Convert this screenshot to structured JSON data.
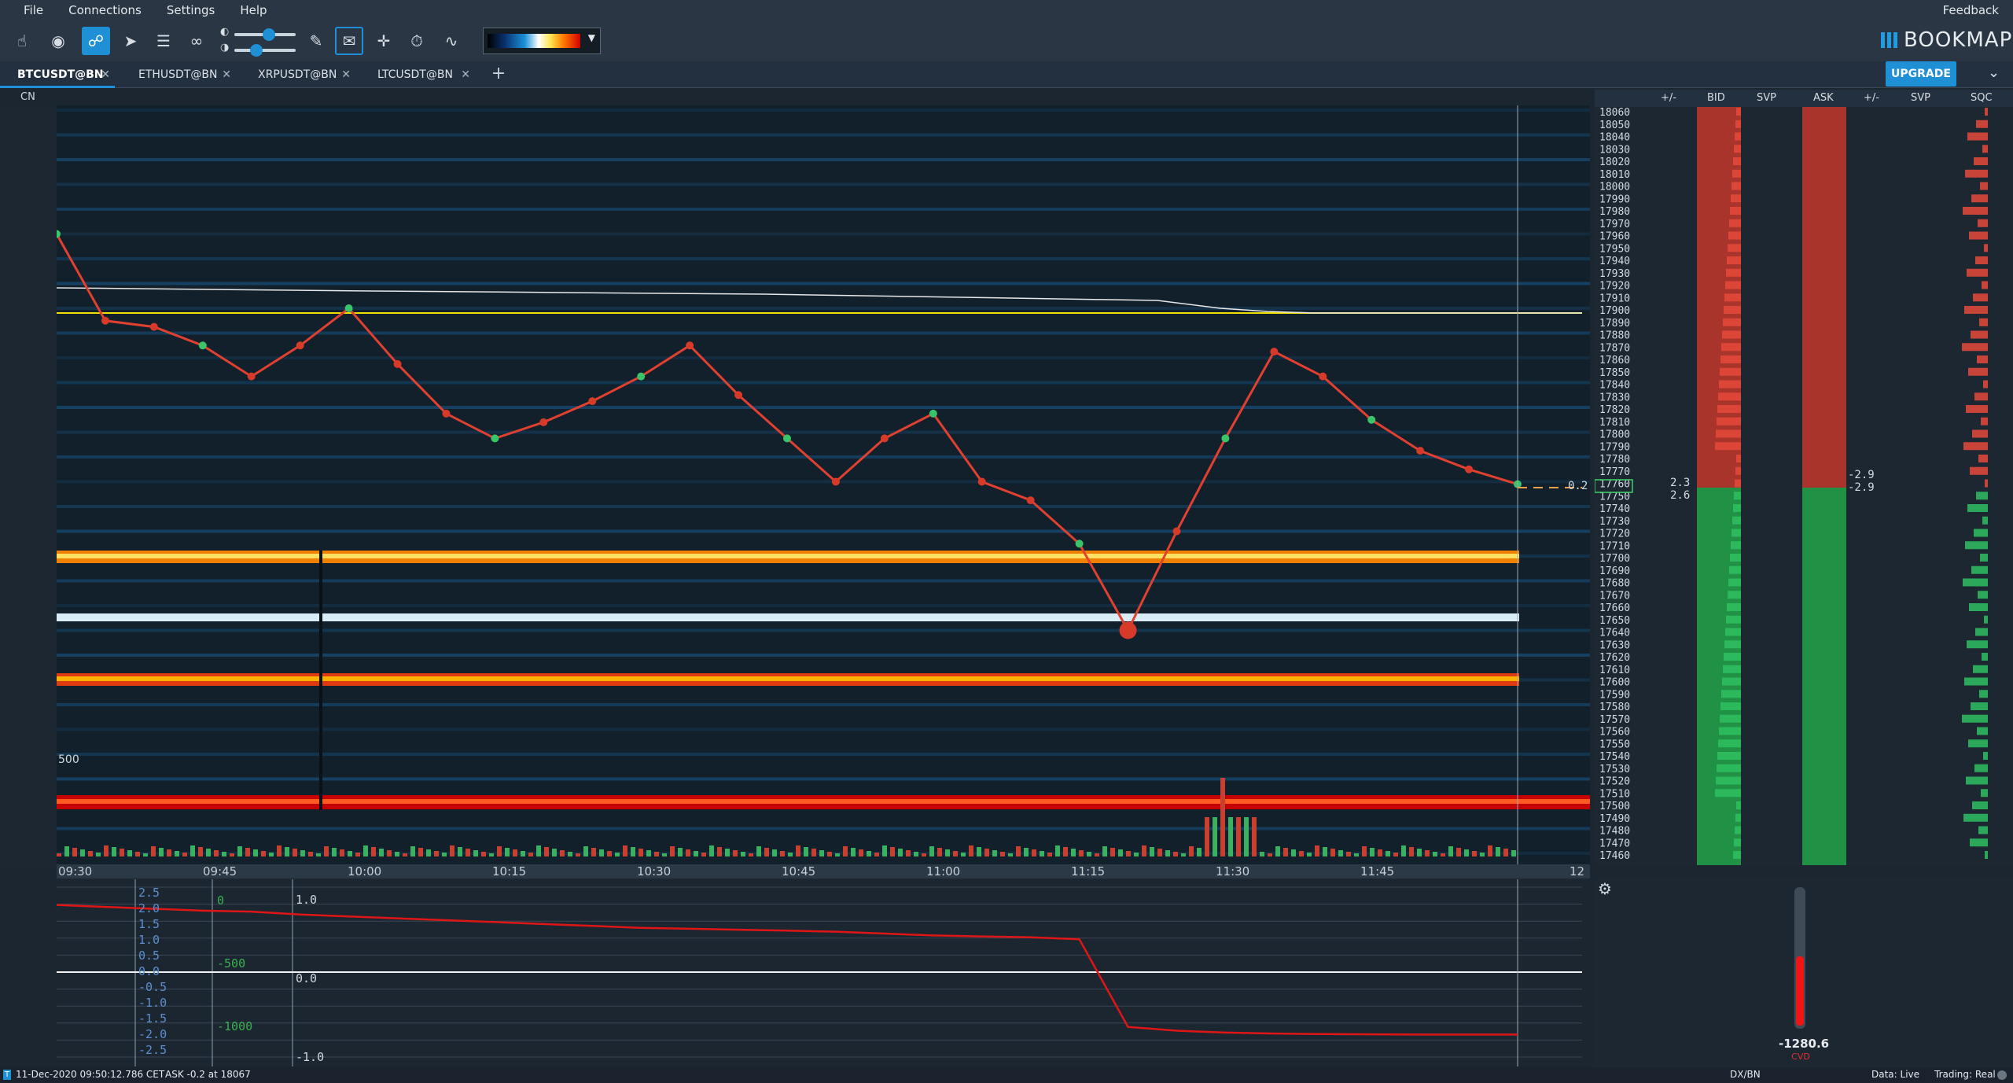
{
  "menu": [
    "File",
    "Connections",
    "Settings",
    "Help"
  ],
  "feedback": "Feedback",
  "brand": "BOOKMAP",
  "upgrade": "UPGRADE",
  "tabs": [
    {
      "label": "BTCUSDT@BN",
      "active": true
    },
    {
      "label": "ETHUSDT@BN",
      "active": false
    },
    {
      "label": "XRPUSDT@BN",
      "active": false
    },
    {
      "label": "LTCUSDT@BN",
      "active": false
    }
  ],
  "chart_label": "CN",
  "min_size_label": "500",
  "ladder_headers": [
    "+/-",
    "BID",
    "SVP",
    "ASK",
    "+/-",
    "SVP",
    "SQC"
  ],
  "price_levels": [
    18060,
    18050,
    18040,
    18030,
    18020,
    18010,
    18000,
    17990,
    17980,
    17970,
    17960,
    17950,
    17940,
    17930,
    17920,
    17910,
    17900,
    17890,
    17880,
    17870,
    17860,
    17850,
    17840,
    17830,
    17820,
    17810,
    17800,
    17790,
    17780,
    17770,
    17760,
    17750,
    17740,
    17730,
    17720,
    17710,
    17700,
    17690,
    17680,
    17670,
    17660,
    17650,
    17640,
    17630,
    17620,
    17610,
    17600,
    17590,
    17580,
    17570,
    17560,
    17550,
    17540,
    17530,
    17520,
    17510,
    17500,
    17490,
    17480,
    17470,
    17460
  ],
  "current_price": "17758",
  "inside_ask_size": "0.2",
  "ladder_side_values": {
    "a": "2.3",
    "b": "2.6",
    "c": "-2.9",
    "d": "-2.9"
  },
  "time_labels": [
    "09:30",
    "09:45",
    "10:00",
    "10:15",
    "10:30",
    "10:45",
    "11:00",
    "11:15",
    "11:30",
    "11:45",
    "12"
  ],
  "lower_left_labels": [
    "2.5",
    "2.0",
    "1.5",
    "1.0",
    "0.5",
    "0.0",
    "-0.5",
    "-1.0",
    "-1.5",
    "-2.0",
    "-2.5"
  ],
  "lower_mid_labels": [
    "0",
    "-500",
    "-1000"
  ],
  "lower_right_labels": [
    "1.0",
    "0.0",
    "-1.0"
  ],
  "cvd": {
    "value": "-1280.6",
    "name": "CVD"
  },
  "status": {
    "datetime": "11-Dec-2020 09:50:12.786 CET",
    "ask_info": "ASK -0.2 at 18067",
    "exchange": "DX/BN",
    "data": "Data: Live",
    "trading": "Trading: Real"
  },
  "colors": {
    "accent": "#1f8fd6",
    "bid": "#219146",
    "ask": "#a8342c",
    "line": "#f0e000",
    "cvd": "#e01616"
  },
  "chart_data": {
    "type": "line",
    "x": [
      "09:30",
      "09:35",
      "09:40",
      "09:45",
      "09:50",
      "09:55",
      "10:00",
      "10:05",
      "10:10",
      "10:15",
      "10:20",
      "10:25",
      "10:30",
      "10:35",
      "10:40",
      "10:45",
      "10:50",
      "10:55",
      "11:00",
      "11:05",
      "11:10",
      "11:15",
      "11:18",
      "11:20",
      "11:22",
      "11:25",
      "11:30",
      "11:35",
      "11:40",
      "11:45",
      "11:50"
    ],
    "series": [
      {
        "values": [
          17960,
          17890,
          17885,
          17870,
          17845,
          17870,
          17900,
          17855,
          17815,
          17795,
          17808,
          17825,
          17845,
          17870,
          17830,
          17795,
          17760,
          17795,
          17815,
          17760,
          17745,
          17710,
          17640,
          17720,
          17795,
          17865,
          17845,
          17810,
          17785,
          17770,
          17758
        ]
      }
    ],
    "ylim": [
      17460,
      18060
    ],
    "cvd_values": [
      80,
      60,
      40,
      20,
      10,
      -20,
      -40,
      -60,
      -80,
      -100,
      -120,
      -140,
      -160,
      -170,
      -180,
      -190,
      -200,
      -220,
      -240,
      -250,
      -260,
      -280,
      -1200,
      -1240,
      -1260,
      -1270,
      -1275,
      -1278,
      -1280,
      -1280,
      -1280.6
    ],
    "cvd_ylim": [
      -1500,
      300
    ]
  }
}
